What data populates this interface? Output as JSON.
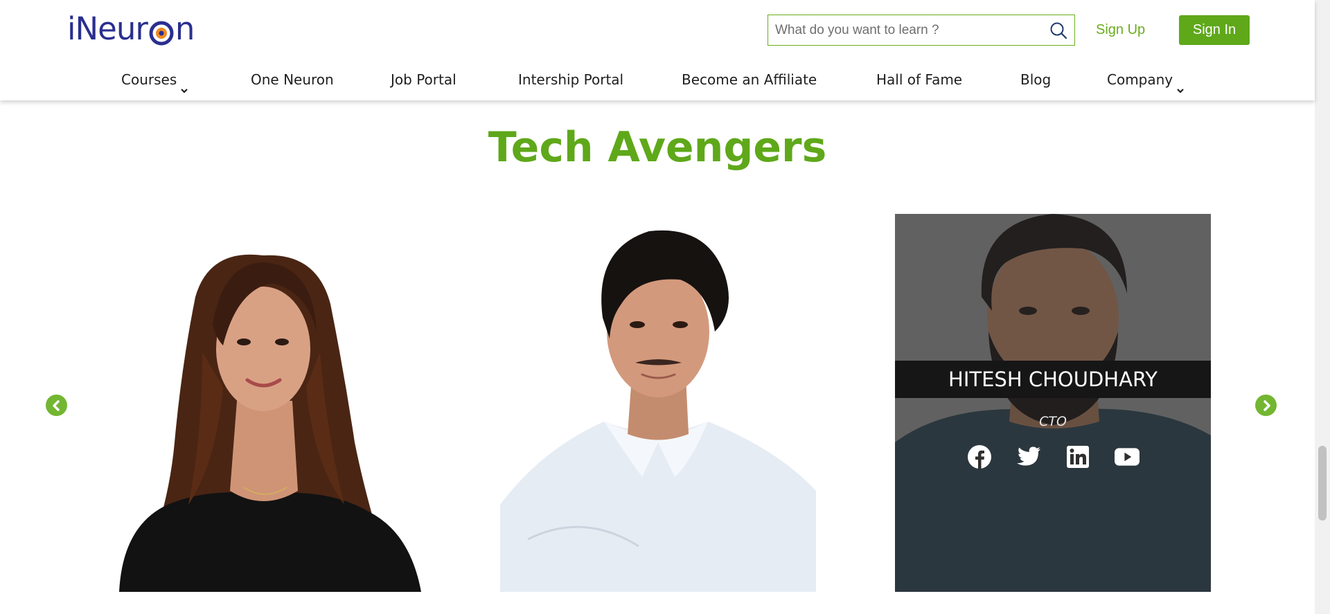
{
  "brand": {
    "logo_text_left": "iNeur",
    "logo_text_right": "n"
  },
  "header": {
    "search_placeholder": "What do you want to learn ?",
    "signup_label": "Sign Up",
    "signin_label": "Sign In"
  },
  "nav": {
    "items": [
      {
        "label": "Courses",
        "dropdown": true
      },
      {
        "label": "One Neuron",
        "dropdown": false
      },
      {
        "label": "Job Portal",
        "dropdown": false
      },
      {
        "label": "Intership Portal",
        "dropdown": false
      },
      {
        "label": "Become an Affiliate",
        "dropdown": false
      },
      {
        "label": "Hall of Fame",
        "dropdown": false
      },
      {
        "label": "Blog",
        "dropdown": false
      },
      {
        "label": "Company",
        "dropdown": true
      }
    ]
  },
  "section": {
    "title": "Tech Avengers"
  },
  "carousel": {
    "cards": [
      {
        "name": "",
        "role": ""
      },
      {
        "name": "",
        "role": ""
      },
      {
        "name": "HITESH CHOUDHARY",
        "role": "CTO",
        "socials": [
          "facebook-icon",
          "twitter-icon",
          "linkedin-icon",
          "youtube-icon"
        ]
      }
    ]
  },
  "colors": {
    "brand_green": "#5fa81a",
    "logo_blue": "#2a2f8f",
    "logo_orange": "#f08a24"
  }
}
